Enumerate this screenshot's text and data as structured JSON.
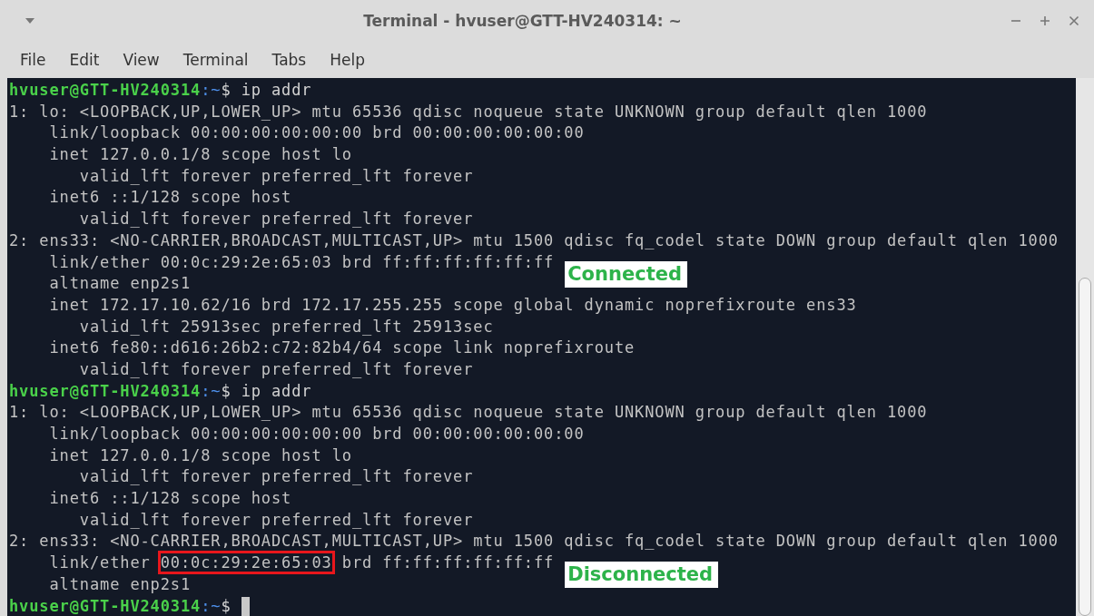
{
  "window": {
    "title": "Terminal - hvuser@GTT-HV240314: ~"
  },
  "menu": [
    {
      "label": "File"
    },
    {
      "label": "Edit"
    },
    {
      "label": "View"
    },
    {
      "label": "Terminal"
    },
    {
      "label": "Tabs"
    },
    {
      "label": "Help"
    }
  ],
  "terminal": {
    "lines": [
      {
        "kind": "prompt",
        "user": "hvuser@GTT-HV240314",
        "path": ":~",
        "command": "$ ip addr",
        "cursor": false
      },
      {
        "kind": "output",
        "parts": [
          {
            "text": "1: lo: <LOOPBACK,UP,LOWER_UP> mtu 65536 qdisc noqueue state UNKNOWN group default qlen 1000",
            "boxed": false
          }
        ]
      },
      {
        "kind": "output",
        "parts": [
          {
            "text": "    link/loopback 00:00:00:00:00:00 brd 00:00:00:00:00:00",
            "boxed": false
          }
        ]
      },
      {
        "kind": "output",
        "parts": [
          {
            "text": "    inet 127.0.0.1/8 scope host lo",
            "boxed": false
          }
        ]
      },
      {
        "kind": "output",
        "parts": [
          {
            "text": "       valid_lft forever preferred_lft forever",
            "boxed": false
          }
        ]
      },
      {
        "kind": "output",
        "parts": [
          {
            "text": "    inet6 ::1/128 scope host",
            "boxed": false
          }
        ]
      },
      {
        "kind": "output",
        "parts": [
          {
            "text": "       valid_lft forever preferred_lft forever",
            "boxed": false
          }
        ]
      },
      {
        "kind": "output",
        "parts": [
          {
            "text": "2: ens33: <NO-CARRIER,BROADCAST,MULTICAST,UP> mtu 1500 qdisc fq_codel state DOWN group default qlen 1000",
            "boxed": false
          }
        ]
      },
      {
        "kind": "output",
        "parts": [
          {
            "text": "    link/ether 00:0c:29:2e:65:03 brd ff:ff:ff:ff:ff:ff",
            "boxed": false
          }
        ],
        "annotation": "Connected"
      },
      {
        "kind": "output",
        "parts": [
          {
            "text": "    altname enp2s1",
            "boxed": false
          }
        ]
      },
      {
        "kind": "output",
        "parts": [
          {
            "text": "    inet 172.17.10.62/16 brd 172.17.255.255 scope global dynamic noprefixroute ens33",
            "boxed": false
          }
        ]
      },
      {
        "kind": "output",
        "parts": [
          {
            "text": "       valid_lft 25913sec preferred_lft 25913sec",
            "boxed": false
          }
        ]
      },
      {
        "kind": "output",
        "parts": [
          {
            "text": "    inet6 fe80::d616:26b2:c72:82b4/64 scope link noprefixroute",
            "boxed": false
          }
        ]
      },
      {
        "kind": "output",
        "parts": [
          {
            "text": "       valid_lft forever preferred_lft forever",
            "boxed": false
          }
        ]
      },
      {
        "kind": "prompt",
        "user": "hvuser@GTT-HV240314",
        "path": ":~",
        "command": "$ ip addr",
        "cursor": false
      },
      {
        "kind": "output",
        "parts": [
          {
            "text": "1: lo: <LOOPBACK,UP,LOWER_UP> mtu 65536 qdisc noqueue state UNKNOWN group default qlen 1000",
            "boxed": false
          }
        ]
      },
      {
        "kind": "output",
        "parts": [
          {
            "text": "    link/loopback 00:00:00:00:00:00 brd 00:00:00:00:00:00",
            "boxed": false
          }
        ]
      },
      {
        "kind": "output",
        "parts": [
          {
            "text": "    inet 127.0.0.1/8 scope host lo",
            "boxed": false
          }
        ]
      },
      {
        "kind": "output",
        "parts": [
          {
            "text": "       valid_lft forever preferred_lft forever",
            "boxed": false
          }
        ]
      },
      {
        "kind": "output",
        "parts": [
          {
            "text": "    inet6 ::1/128 scope host",
            "boxed": false
          }
        ]
      },
      {
        "kind": "output",
        "parts": [
          {
            "text": "       valid_lft forever preferred_lft forever",
            "boxed": false
          }
        ]
      },
      {
        "kind": "output",
        "parts": [
          {
            "text": "2: ens33: <NO-CARRIER,BROADCAST,MULTICAST,UP> mtu 1500 qdisc fq_codel state DOWN group default qlen 1000",
            "boxed": false
          }
        ]
      },
      {
        "kind": "output",
        "parts": [
          {
            "text": "    link/ether ",
            "boxed": false
          },
          {
            "text": "00:0c:29:2e:65:03",
            "boxed": true
          },
          {
            "text": " brd ff:ff:ff:ff:ff:ff",
            "boxed": false
          }
        ],
        "annotation": "Disconnected"
      },
      {
        "kind": "output",
        "parts": [
          {
            "text": "    altname enp2s1",
            "boxed": false
          }
        ]
      },
      {
        "kind": "prompt",
        "user": "hvuser@GTT-HV240314",
        "path": ":~",
        "command": "$ ",
        "cursor": true
      }
    ]
  }
}
